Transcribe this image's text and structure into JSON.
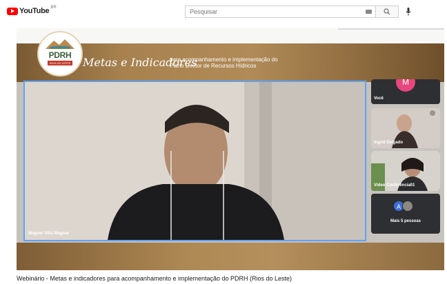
{
  "header": {
    "brand": "YouTube",
    "country_code": "BR",
    "search_placeholder": "Pesquisar"
  },
  "icons": {
    "logo": "youtube-play-logo",
    "keyboard": "keyboard-icon",
    "search": "search-icon",
    "mic": "mic-icon"
  },
  "banner": {
    "logo_text": "PDRH",
    "logo_sub": "RIOS DO LESTE",
    "title": "Metas e Indicadores",
    "subtitle_line1": "para acompanhamento e implementação do",
    "subtitle_line2": "Plano Diretor de Recursos Hídricos"
  },
  "meeting": {
    "main_speaker": "Wagner Villa Wagner",
    "participants": [
      {
        "label": "Você",
        "avatar": "M"
      },
      {
        "label": "Ingrid Delgado"
      },
      {
        "label": "Vídeo Conferência01"
      }
    ],
    "more": {
      "avatar_letter": "A",
      "label": "Mais 5 pessoas"
    }
  },
  "colors": {
    "accent_red": "#ff0000",
    "speaker_border": "#5aa3ff",
    "avatar_pink": "#e8467c",
    "avatar_blue": "#3b6ed8",
    "banner_brown": "#a7824f"
  },
  "video": {
    "title": "Webinário - Metas e indicadores para acompanhamento e implementação do PDRH (Rios do Leste)"
  }
}
